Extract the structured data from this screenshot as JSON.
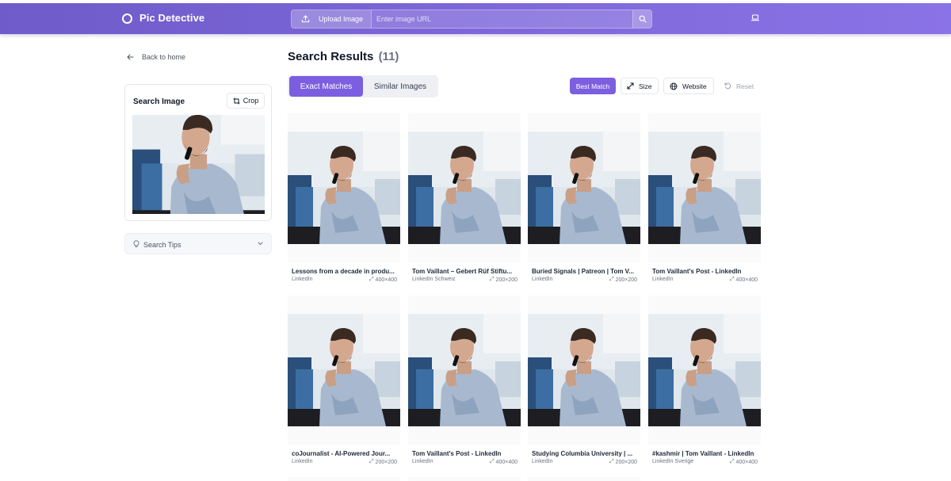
{
  "app": {
    "name": "Pic Detective"
  },
  "header": {
    "upload_label": "Upload Image",
    "url_placeholder": "Enter image URL",
    "url_value": ""
  },
  "sidebar": {
    "back_label": "Back to home",
    "search_card_title": "Search Image",
    "crop_label": "Crop",
    "tips_label": "Search Tips"
  },
  "results": {
    "title": "Search Results",
    "count": "(11)",
    "tabs": [
      {
        "label": "Exact Matches",
        "active": true
      },
      {
        "label": "Similar Images",
        "active": false
      }
    ],
    "sort": {
      "best": "Best Match",
      "size": "Size",
      "website": "Website",
      "reset": "Reset"
    },
    "items": [
      {
        "title": "Lessons from a decade in produ...",
        "source": "LinkedIn",
        "dims": "400×400"
      },
      {
        "title": "Tom Vaillant – Gebert Rüf Stiftu...",
        "source": "LinkedIn Schweiz",
        "dims": "200×200"
      },
      {
        "title": "Buried Signals | Patreon | Tom V...",
        "source": "LinkedIn",
        "dims": "200×200"
      },
      {
        "title": "Tom Vaillant's Post - LinkedIn",
        "source": "LinkedIn",
        "dims": "400×400"
      },
      {
        "title": "coJournalist - AI-Powered Jour...",
        "source": "LinkedIn",
        "dims": "200×200"
      },
      {
        "title": "Tom Vaillant's Post - LinkedIn",
        "source": "LinkedIn",
        "dims": "400×400"
      },
      {
        "title": "Studying Columbia University | ...",
        "source": "LinkedIn",
        "dims": "200×200"
      },
      {
        "title": "#kashmir | Tom Vaillant - LinkedIn",
        "source": "LinkedIn Sverige",
        "dims": "400×400"
      }
    ]
  },
  "colors": {
    "accent": "#7c5fe0",
    "navbar_start": "#6f5bc9",
    "navbar_end": "#8a73e6"
  },
  "icons": {
    "logo": "circle-logo-icon",
    "upload": "upload-icon",
    "search": "search-icon",
    "device": "laptop-icon",
    "back": "arrow-left-icon",
    "crop": "crop-icon",
    "tips": "lightbulb-icon",
    "expand": "chevron-down-icon",
    "size": "resize-icon",
    "website": "globe-icon",
    "reset": "reset-icon",
    "dims": "expand-arrows-icon"
  }
}
